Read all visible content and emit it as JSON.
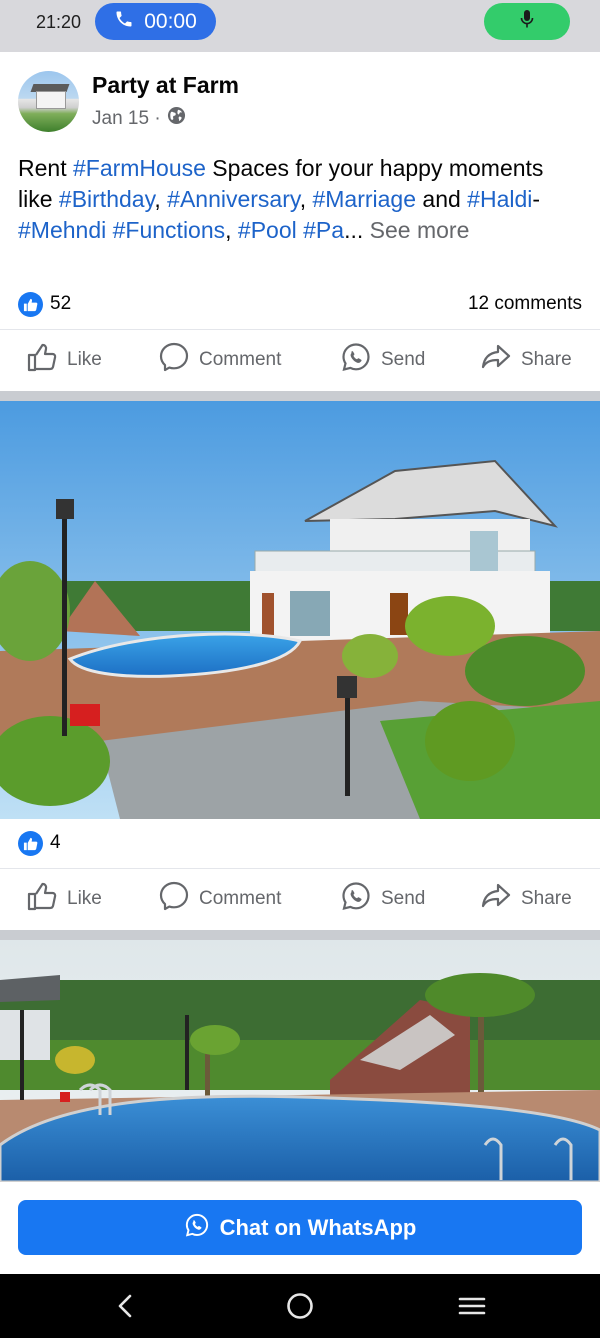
{
  "status_bar": {
    "time": "21:20",
    "call_timer": "00:00",
    "icons": [
      "phone-icon",
      "microphone-icon"
    ]
  },
  "post": {
    "page_name": "Party at Farm",
    "date": "Jan 15 ·",
    "privacy_icon": "globe-icon",
    "text": {
      "w1": "Rent ",
      "t1": "#FarmHouse",
      "w2": " Spaces for your happy moments like ",
      "t2": "#Birthday",
      "w3": ", ",
      "t3": "#Anniversary",
      "w4": ", ",
      "t4": "#Marriage",
      "w5": " and ",
      "t5": "#Haldi",
      "w6": "-",
      "t6": "#Mehndi",
      "w7": " ",
      "t7": "#Functions",
      "w8": ", ",
      "t8": "#Pool",
      "w9": " ",
      "t9": "#Pa",
      "ellipsis": "...",
      "see_more": " See more"
    },
    "reactions": {
      "count": "52",
      "comments": "12 comments"
    }
  },
  "photo_post": {
    "reactions": {
      "count": "4"
    }
  },
  "actions": {
    "like": "Like",
    "comment": "Comment",
    "send": "Send",
    "share": "Share"
  },
  "cta": {
    "label": "Chat on WhatsApp",
    "icon": "whatsapp-icon"
  },
  "nav": {
    "icons": [
      "back-icon",
      "home-icon",
      "menu-icon"
    ]
  },
  "colors": {
    "brand_blue": "#1877f2",
    "hashtag": "#1d63c9",
    "call_pill": "#2f6fe6",
    "mic_pill": "#33cc6b"
  }
}
